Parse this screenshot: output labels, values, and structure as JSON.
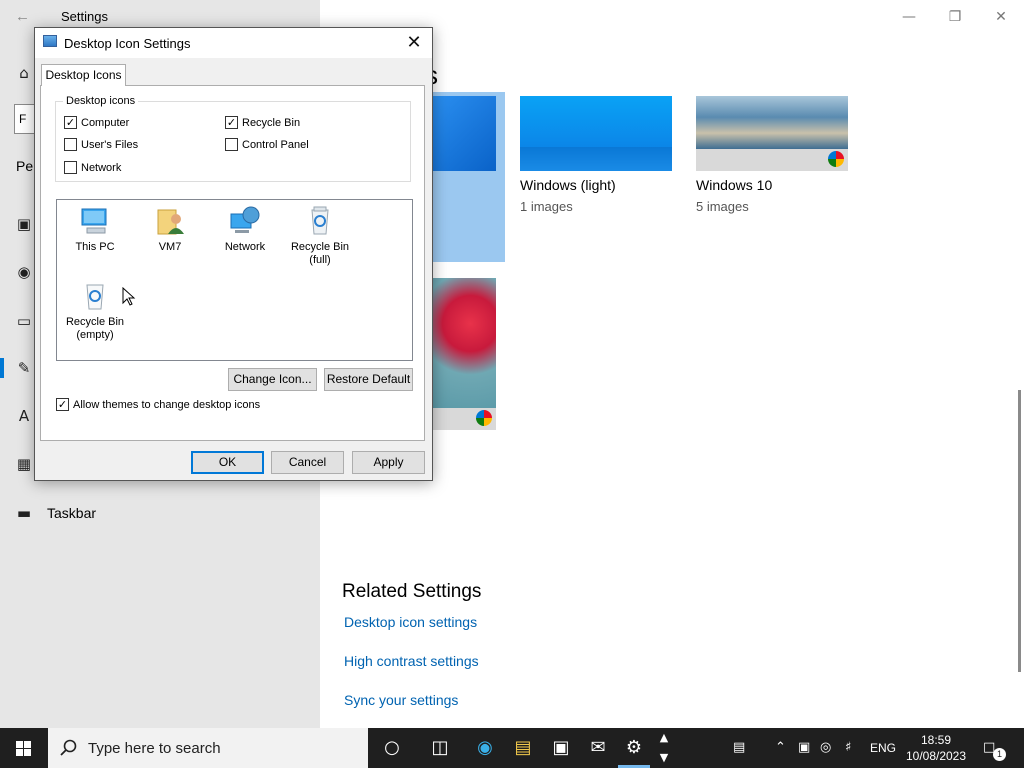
{
  "settings": {
    "window_title": "Settings",
    "sidebar": {
      "search_fragment": "F",
      "section_fragment": "Per",
      "items": [
        {
          "icon": "picture-icon"
        },
        {
          "icon": "palette-icon"
        },
        {
          "icon": "lockscreen-icon"
        },
        {
          "icon": "pen-icon"
        },
        {
          "icon": "fonts-icon"
        },
        {
          "icon": "start-icon"
        },
        {
          "icon": "taskbar-icon",
          "label": "Taskbar"
        }
      ]
    },
    "header_fragment": "s",
    "themes": [
      {
        "name": "Windows (light)",
        "count": "1 images"
      },
      {
        "name": "Windows 10",
        "count": "5 images"
      }
    ],
    "related": {
      "title": "Related Settings",
      "links": [
        "Desktop icon settings",
        "High contrast settings",
        "Sync your settings"
      ]
    }
  },
  "dialog": {
    "title": "Desktop Icon Settings",
    "tab": "Desktop Icons",
    "group_label": "Desktop icons",
    "checkboxes": [
      {
        "label": "Computer",
        "checked": true
      },
      {
        "label": "Recycle Bin",
        "checked": true
      },
      {
        "label": "User's Files",
        "checked": false
      },
      {
        "label": "Control Panel",
        "checked": false
      },
      {
        "label": "Network",
        "checked": false
      }
    ],
    "icons": [
      {
        "label": "This PC"
      },
      {
        "label": "VM7"
      },
      {
        "label": "Network"
      },
      {
        "label": "Recycle Bin (full)"
      },
      {
        "label": "Recycle Bin (empty)"
      }
    ],
    "change_icon": "Change Icon...",
    "restore_default": "Restore Default",
    "allow_themes": {
      "label": "Allow themes to change desktop icons",
      "checked": true
    },
    "ok": "OK",
    "cancel": "Cancel",
    "apply": "Apply"
  },
  "taskbar": {
    "search_placeholder": "Type here to search",
    "language": "ENG",
    "time": "18:59",
    "date": "10/08/2023",
    "notification_count": "1"
  },
  "colors": {
    "accent": "#0078d4",
    "link": "#0063b1",
    "taskbar": "#1f1f1f"
  }
}
